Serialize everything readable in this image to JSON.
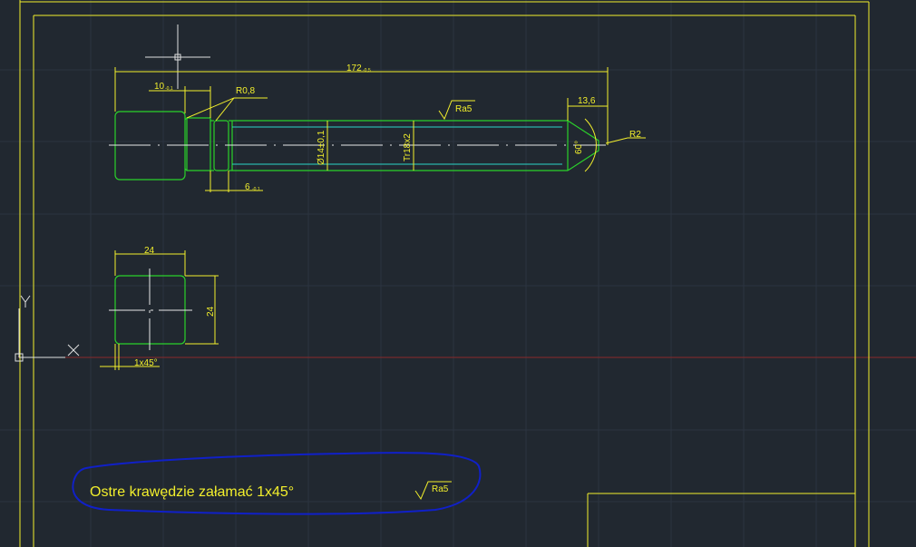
{
  "app": "CAD drawing viewport",
  "colors": {
    "background": "#212830",
    "grid": "#2c3440",
    "frame": "#f2ef2c",
    "outline": "#2bd12b",
    "thread": "#2ad6c8",
    "dimension": "#f2ef2c",
    "centerline": "#e8e8e8",
    "x_axis_line": "#8a2a2a",
    "highlight_markup": "#1020c8",
    "ucs": "#e0e0e0"
  },
  "dimensions": {
    "overall_length": "172",
    "overall_length_tol": "-0,5",
    "head_length": "10",
    "head_length_tol": "-0,1",
    "fillet_radius": "R0,8",
    "groove_width": "6",
    "groove_width_tol": "-0,1",
    "tip_length": "13,6",
    "tip_radius": "R2",
    "tip_angle": "60°",
    "bore_diameter": "Ø14±0,1",
    "thread_spec": "Tr18x2",
    "roughness_top": "Ra5",
    "square_width": "24",
    "square_height": "24",
    "chamfer": "1x45°"
  },
  "note": {
    "text": "Ostre krawędzie załamać 1x45°",
    "roughness": "Ra5"
  },
  "ucs": {
    "x_label": "X",
    "y_label": "Y"
  }
}
